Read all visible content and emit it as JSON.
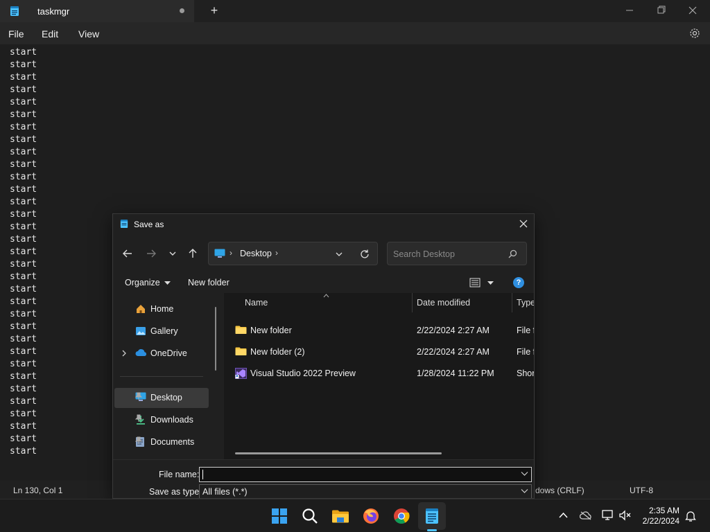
{
  "notepad": {
    "tab_title": "taskmgr",
    "new_tab_label": "+",
    "menu": [
      "File",
      "Edit",
      "View"
    ],
    "lines": [
      "start",
      "start",
      "start",
      "start",
      "start",
      "start",
      "start",
      "start",
      "start",
      "start",
      "start",
      "start",
      "start",
      "start",
      "start",
      "start",
      "start",
      "start",
      "start",
      "start",
      "start",
      "start",
      "start",
      "start",
      "start",
      "start",
      "start",
      "start",
      "start",
      "start",
      "start",
      "start",
      "start"
    ],
    "status": {
      "position": "Ln 130, Col 1",
      "line_ending": "dows (CRLF)",
      "encoding": "UTF-8"
    }
  },
  "dialog": {
    "title": "Save as",
    "address_location": "Desktop",
    "search_placeholder": "Search Desktop",
    "organize_label": "Organize",
    "new_folder_label": "New folder",
    "help_label": "?",
    "nav_items": [
      {
        "label": "Home",
        "icon": "home-icon"
      },
      {
        "label": "Gallery",
        "icon": "gallery-icon"
      },
      {
        "label": "OneDrive",
        "icon": "onedrive-icon"
      },
      {
        "label": "Desktop",
        "icon": "desktop-icon",
        "pinned": true,
        "selected": true
      },
      {
        "label": "Downloads",
        "icon": "downloads-icon",
        "pinned": true
      },
      {
        "label": "Documents",
        "icon": "documents-icon",
        "pinned": true
      }
    ],
    "columns": {
      "name": "Name",
      "date": "Date modified",
      "type": "Type"
    },
    "files": [
      {
        "name": "New folder",
        "date": "2/22/2024 2:27 AM",
        "type": "File fo",
        "icon": "folder-icon"
      },
      {
        "name": "New folder (2)",
        "date": "2/22/2024 2:27 AM",
        "type": "File fo",
        "icon": "folder-icon"
      },
      {
        "name": "Visual Studio 2022 Preview",
        "date": "1/28/2024 11:22 PM",
        "type": "Short",
        "icon": "visual-studio-icon"
      }
    ],
    "file_name_label": "File name:",
    "file_name_value": "",
    "save_type_label": "Save as type:",
    "save_type_value": "All files  (*.*)"
  },
  "taskbar": {
    "time": "2:35 AM",
    "date": "2/22/2024",
    "apps": [
      "start-icon",
      "search-icon",
      "file-explorer-icon",
      "firefox-icon",
      "chrome-icon",
      "notepad-icon"
    ]
  },
  "colors": {
    "accent": "#4cc2ff",
    "folder": "#f4c542"
  }
}
